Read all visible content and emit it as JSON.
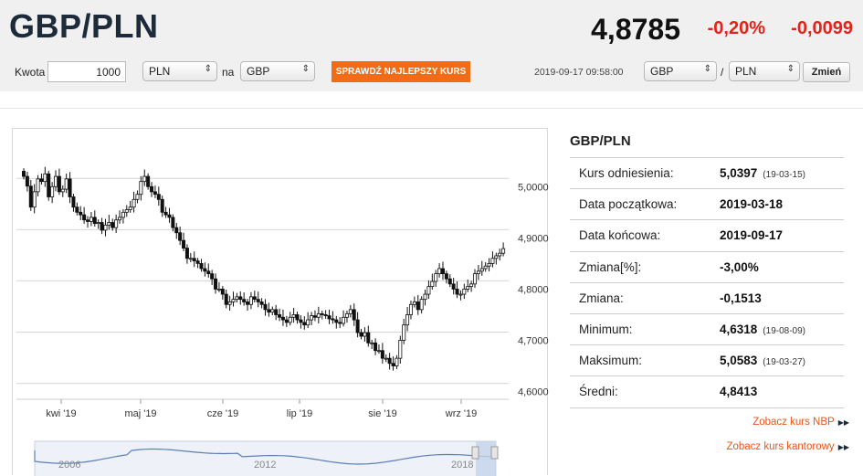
{
  "header": {
    "pair": "GBP/PLN",
    "rate": "4,8785",
    "change_pct": "-0,20%",
    "change_abs": "-0,0099"
  },
  "converter": {
    "amount_label": "Kwota",
    "amount_value": "1000",
    "from_currency": "PLN",
    "on_label": "na",
    "to_currency": "GBP",
    "best_rate_button": "SPRAWDŹ NAJLEPSZY KURS",
    "timestamp": "2019-09-17 09:58:00",
    "pair_base": "GBP",
    "slash": "/",
    "pair_quote": "PLN",
    "change_button": "Zmień"
  },
  "colors": {
    "accent": "#f26b17",
    "negative": "#e0241b",
    "title": "#1d2a3a",
    "link": "#e8551c"
  },
  "chart_data": {
    "type": "candlestick",
    "x_ticks": [
      "kwi '19",
      "maj '19",
      "cze '19",
      "lip '19",
      "sie '19",
      "wrz '19"
    ],
    "y_ticks": [
      "5,0000",
      "4,9000",
      "4,8000",
      "4,7000",
      "4,6000"
    ],
    "ylim": [
      4.585,
      5.095
    ],
    "grid": true,
    "closes": [
      5.02,
      5.001,
      4.96,
      4.99,
      5.015,
      5.01,
      5.025,
      4.98,
      5.0,
      5.02,
      4.99,
      4.995,
      5.015,
      4.98,
      4.96,
      4.95,
      4.945,
      4.935,
      4.932,
      4.94,
      4.928,
      4.93,
      4.915,
      4.925,
      4.93,
      4.92,
      4.935,
      4.94,
      4.95,
      4.955,
      4.96,
      4.975,
      4.985,
      5.01,
      5.02,
      5.0,
      4.99,
      4.985,
      4.975,
      4.95,
      4.945,
      4.94,
      4.92,
      4.91,
      4.895,
      4.88,
      4.86,
      4.86,
      4.855,
      4.85,
      4.84,
      4.835,
      4.83,
      4.82,
      4.8,
      4.8,
      4.79,
      4.77,
      4.775,
      4.78,
      4.785,
      4.78,
      4.775,
      4.77,
      4.785,
      4.78,
      4.775,
      4.77,
      4.76,
      4.755,
      4.76,
      4.75,
      4.745,
      4.74,
      4.735,
      4.745,
      4.75,
      4.74,
      4.735,
      4.73,
      4.74,
      4.748,
      4.745,
      4.752,
      4.75,
      4.748,
      4.742,
      4.74,
      4.735,
      4.733,
      4.745,
      4.752,
      4.76,
      4.74,
      4.715,
      4.708,
      4.715,
      4.695,
      4.695,
      4.68,
      4.68,
      4.665,
      4.665,
      4.655,
      4.65,
      4.665,
      4.7,
      4.73,
      4.75,
      4.77,
      4.775,
      4.76,
      4.78,
      4.79,
      4.805,
      4.815,
      4.83,
      4.84,
      4.83,
      4.82,
      4.81,
      4.8,
      4.79,
      4.79,
      4.8,
      4.805,
      4.81,
      4.83,
      4.835,
      4.84,
      4.845,
      4.85,
      4.86,
      4.865,
      4.87,
      4.879
    ],
    "navigator": {
      "labels": [
        "2006",
        "2012",
        "2018"
      ]
    }
  },
  "info": {
    "title": "GBP/PLN",
    "rows": [
      {
        "label": "Kurs odniesienia:",
        "value": "5,0397",
        "date": "(19-03-15)"
      },
      {
        "label": "Data początkowa:",
        "value": "2019-03-18",
        "date": ""
      },
      {
        "label": "Data końcowa:",
        "value": "2019-09-17",
        "date": ""
      },
      {
        "label": "Zmiana[%]:",
        "value": "-3,00%",
        "date": ""
      },
      {
        "label": "Zmiana:",
        "value": "-0,1513",
        "date": ""
      },
      {
        "label": "Minimum:",
        "value": "4,6318",
        "date": "(19-08-09)"
      },
      {
        "label": "Maksimum:",
        "value": "5,0583",
        "date": "(19-03-27)"
      },
      {
        "label": "Średni:",
        "value": "4,8413",
        "date": ""
      }
    ],
    "link_nbp": "Zobacz kurs NBP",
    "link_kantor": "Zobacz kurs kantorowy",
    "link_icon": "double-triangle-right-icon"
  }
}
